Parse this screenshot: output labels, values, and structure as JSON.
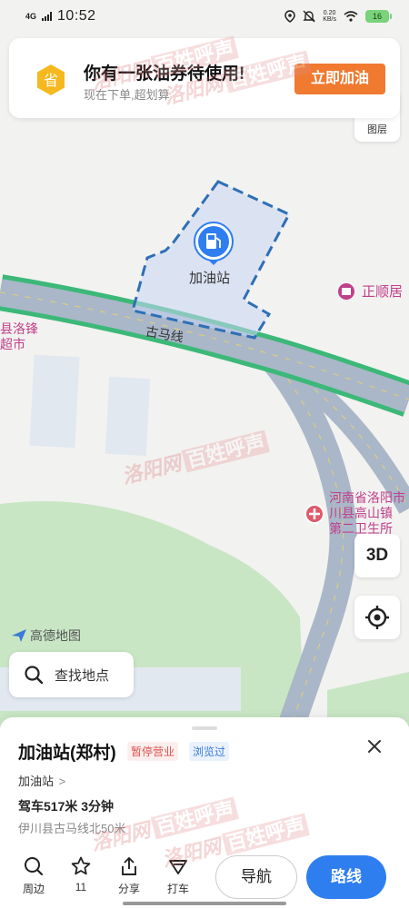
{
  "status_bar": {
    "network": "4G",
    "time": "10:52",
    "speed_value": "0.20",
    "speed_unit": "KB/s",
    "battery": "16",
    "battery_color": "#7ad27a"
  },
  "coupon": {
    "badge_char": "省",
    "title": "你有一张油券待使用!",
    "subtitle": "现在下单,超划算",
    "button": "立即加油",
    "button_color": "#f07a30"
  },
  "map": {
    "layer_label": "图层",
    "btn_3d": "3D",
    "station_label": "加油站",
    "road_label": "古马线",
    "poi_zhengshun": "正顺居",
    "poi_luofeng_1": "县洛锋",
    "poi_luofeng_2": "超市",
    "poi_clinic_1": "河南省洛阳市",
    "poi_clinic_2": "川县高山镇",
    "poi_clinic_3": "第二卫生所",
    "brand": "高德地图"
  },
  "search": {
    "placeholder": "查找地点"
  },
  "poi": {
    "title": "加油站(郑村)",
    "tag_closed": "暂停营业",
    "tag_viewed": "浏览过",
    "category": "加油站",
    "category_chevron": ">",
    "drive": "驾车517米 3分钟",
    "address": "伊川县古马线北50米"
  },
  "actions": {
    "nearby": "周边",
    "favorite_count": "11",
    "share": "分享",
    "taxi": "打车",
    "navigate": "导航",
    "route": "路线",
    "route_color": "#2f7ef0"
  },
  "watermark": {
    "part1": "洛阳网",
    "part2": "百姓呼声"
  },
  "icons": {
    "search": "search-icon",
    "star": "star-icon",
    "share": "share-icon",
    "taxi": "taxi-icon",
    "locate": "locate-icon",
    "close": "close-icon",
    "fuel": "fuel-pump-icon"
  }
}
